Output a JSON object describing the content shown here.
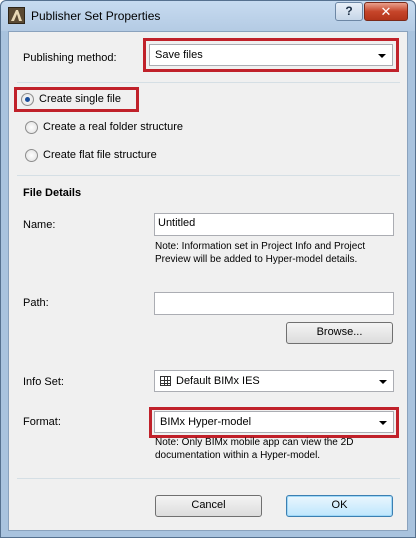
{
  "window": {
    "title": "Publisher Set Properties",
    "help_label": "?",
    "close_label": "✕"
  },
  "publishing": {
    "label": "Publishing method:",
    "value": "Save files"
  },
  "structure_options": [
    {
      "label": "Create single file",
      "checked": true
    },
    {
      "label": "Create a real folder structure",
      "checked": false
    },
    {
      "label": "Create flat file structure",
      "checked": false
    }
  ],
  "file_details": {
    "heading": "File Details",
    "name_label": "Name:",
    "name_value": "Untitled",
    "name_note_1": "Note: Information set in Project Info and Project",
    "name_note_2": "Preview will be added to Hyper-model details.",
    "path_label": "Path:",
    "path_value": "",
    "browse_label": "Browse...",
    "info_set_label": "Info Set:",
    "info_set_value": "Default BIMx IES",
    "format_label": "Format:",
    "format_value": "BIMx Hyper-model",
    "format_note_1": "Note: Only BIMx mobile app can view the 2D",
    "format_note_2": "documentation within a Hyper-model."
  },
  "footer": {
    "cancel_label": "Cancel",
    "ok_label": "OK"
  },
  "colors": {
    "highlight_frame": "#c0212a",
    "radio_dot": "#1c4f9b",
    "window_frame": "#a9c3de"
  },
  "icons": [
    "app-icon",
    "help-icon",
    "close-icon",
    "chevron-down-icon",
    "grid-icon"
  ]
}
